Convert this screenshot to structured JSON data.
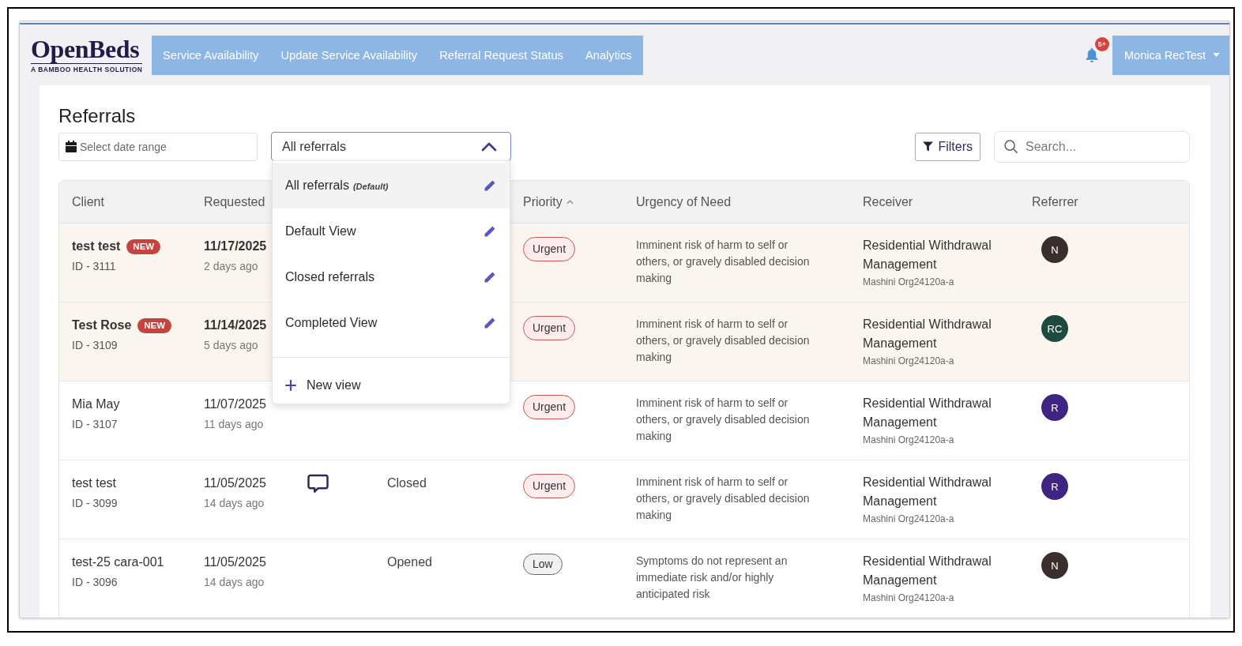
{
  "header": {
    "logo": {
      "name": "OpenBeds",
      "tagline": "A BAMBOO HEALTH SOLUTION"
    },
    "nav": [
      {
        "label": "Service Availability"
      },
      {
        "label": "Update Service Availability"
      },
      {
        "label": "Referral Request Status"
      },
      {
        "label": "Analytics"
      }
    ],
    "notifications": {
      "badge": "5+"
    },
    "user_menu": {
      "label": "Monica RecTest"
    }
  },
  "page": {
    "title": "Referrals"
  },
  "date_range": {
    "placeholder": "Select date range"
  },
  "view_select": {
    "value": "All referrals",
    "expanded": true,
    "options": [
      {
        "label": "All referrals",
        "note": "(Default)",
        "selected": true
      },
      {
        "label": "Default View",
        "selected": false
      },
      {
        "label": "Closed referrals",
        "selected": false
      },
      {
        "label": "Completed View",
        "selected": false
      }
    ],
    "new_view": "New view"
  },
  "filters_button": {
    "label": "Filters"
  },
  "search": {
    "placeholder": "Search..."
  },
  "table": {
    "columns": [
      {
        "label": "Client",
        "sorted": false
      },
      {
        "label": "Requested",
        "sorted": false
      },
      {
        "label": "Priority",
        "sorted": true
      },
      {
        "label": "Urgency of Need",
        "sorted": false
      },
      {
        "label": "Receiver",
        "sorted": false
      },
      {
        "label": "Referrer",
        "sorted": false
      }
    ],
    "rows": [
      {
        "unread": true,
        "client": "test test",
        "badge": "NEW",
        "id": "ID - 3111",
        "date": "11/17/2025",
        "ago": "2 days ago",
        "priority": {
          "kind": "urgent",
          "label": "Urgent"
        },
        "urgency": "Imminent risk of harm to self or others, or gravely disabled decision making",
        "receiver": "Residential Withdrawal Management",
        "org": "Mashini Org24120a-a",
        "referrer": {
          "initials": "N",
          "color": "#3a2f2d"
        }
      },
      {
        "unread": true,
        "client": "Test Rose",
        "badge": "NEW",
        "id": "ID - 3109",
        "date": "11/14/2025",
        "ago": "5 days ago",
        "priority": {
          "kind": "urgent",
          "label": "Urgent"
        },
        "urgency": "Imminent risk of harm to self or others, or gravely disabled decision making",
        "receiver": "Residential Withdrawal Management",
        "org": "Mashini Org24120a-a",
        "referrer": {
          "initials": "RC",
          "color": "#1f4a40"
        }
      },
      {
        "unread": false,
        "client": "Mia May",
        "id": "ID - 3107",
        "date": "11/07/2025",
        "ago": "11 days ago",
        "priority": {
          "kind": "urgent",
          "label": "Urgent"
        },
        "urgency": "Imminent risk of harm to self or others, or gravely disabled decision making",
        "receiver": "Residential Withdrawal Management",
        "org": "Mashini Org24120a-a",
        "referrer": {
          "initials": "R",
          "color": "#3f2483"
        }
      },
      {
        "unread": false,
        "client": "test test",
        "id": "ID - 3099",
        "date": "11/05/2025",
        "ago": "14 days ago",
        "comment": true,
        "status": "Closed",
        "priority": {
          "kind": "urgent",
          "label": "Urgent"
        },
        "urgency": "Imminent risk of harm to self or others, or gravely disabled decision making",
        "receiver": "Residential Withdrawal Management",
        "org": "Mashini Org24120a-a",
        "referrer": {
          "initials": "R",
          "color": "#3f2483"
        }
      },
      {
        "unread": false,
        "client": "test-25 cara-001",
        "id": "ID - 3096",
        "date": "11/05/2025",
        "ago": "14 days ago",
        "comment": false,
        "status": "Opened",
        "priority": {
          "kind": "low",
          "label": "Low"
        },
        "urgency": "Symptoms do not represent an immediate risk and/or highly anticipated risk",
        "receiver": "Residential Withdrawal Management",
        "org": "Mashini Org24120a-a",
        "referrer": {
          "initials": "N",
          "color": "#3a2f2d"
        }
      }
    ]
  }
}
